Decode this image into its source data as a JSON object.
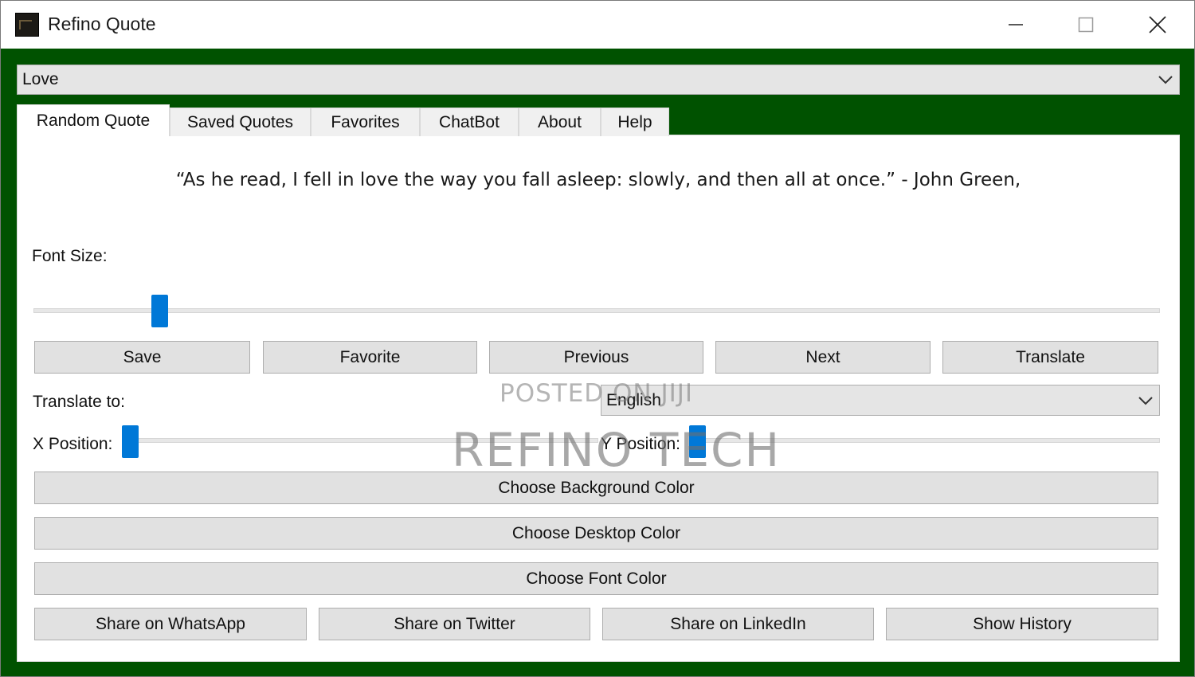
{
  "window": {
    "title": "Refino Quote",
    "icon": "app-logo-icon"
  },
  "category": {
    "selected": "Love"
  },
  "tabs": [
    {
      "label": "Random Quote",
      "active": true
    },
    {
      "label": "Saved Quotes",
      "active": false
    },
    {
      "label": "Favorites",
      "active": false
    },
    {
      "label": "ChatBot",
      "active": false
    },
    {
      "label": "About",
      "active": false
    },
    {
      "label": "Help",
      "active": false
    }
  ],
  "quote": {
    "text": "“As he read, I fell in love the way you fall asleep: slowly, and then all at once.” - John Green,"
  },
  "font_size": {
    "label": "Font Size:",
    "value_fraction": 0.106
  },
  "action_buttons": {
    "save": "Save",
    "favorite": "Favorite",
    "previous": "Previous",
    "next": "Next",
    "translate": "Translate"
  },
  "translate_to": {
    "label": "Translate to:",
    "selected": "English"
  },
  "x_position": {
    "label": "X Position:",
    "value_fraction": 0.0
  },
  "y_position": {
    "label": "Y Position:",
    "value_fraction": 0.0
  },
  "color_buttons": {
    "background": "Choose Background Color",
    "desktop": "Choose Desktop Color",
    "font": "Choose Font Color"
  },
  "share_buttons": {
    "whatsapp": "Share on WhatsApp",
    "twitter": "Share on Twitter",
    "linkedin": "Share on LinkedIn",
    "history": "Show History"
  },
  "watermarks": {
    "posted": "POSTED ON JIJI",
    "brand": "REFINO TECH"
  },
  "colors": {
    "frame_green": "#005200",
    "accent_blue": "#0078d7",
    "button_gray": "#e1e1e1"
  }
}
